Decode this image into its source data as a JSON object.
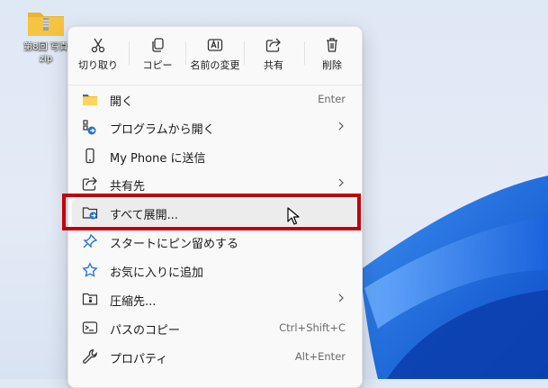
{
  "desktop": {
    "icon_name": "folder-zip-icon",
    "label_line1": "第8回 写真",
    "label_line2": "zip"
  },
  "context_menu": {
    "quick_actions": [
      {
        "label": "切り取り",
        "icon": "scissors-icon"
      },
      {
        "label": "コピー",
        "icon": "copy-icon"
      },
      {
        "label": "名前の変更",
        "icon": "rename-icon"
      },
      {
        "label": "共有",
        "icon": "share-icon"
      },
      {
        "label": "削除",
        "icon": "trash-icon"
      }
    ],
    "items": [
      {
        "label": "開く",
        "shortcut": "Enter",
        "icon": "folder-open-icon",
        "submenu": false
      },
      {
        "label": "プログラムから開く",
        "shortcut": "",
        "icon": "open-with-icon",
        "submenu": true
      },
      {
        "label": "My Phone に送信",
        "shortcut": "",
        "icon": "phone-icon",
        "submenu": false
      },
      {
        "label": "共有先",
        "shortcut": "",
        "icon": "share-icon",
        "submenu": true
      },
      {
        "label": "すべて展開...",
        "shortcut": "",
        "icon": "extract-all-icon",
        "submenu": false
      },
      {
        "label": "スタートにピン留めする",
        "shortcut": "",
        "icon": "pin-icon",
        "submenu": false
      },
      {
        "label": "お気に入りに追加",
        "shortcut": "",
        "icon": "star-icon",
        "submenu": false
      },
      {
        "label": "圧縮先...",
        "shortcut": "",
        "icon": "compress-icon",
        "submenu": true
      },
      {
        "label": "パスのコピー",
        "shortcut": "Ctrl+Shift+C",
        "icon": "copy-path-icon",
        "submenu": false
      },
      {
        "label": "プロパティ",
        "shortcut": "Alt+Enter",
        "icon": "wrench-icon",
        "submenu": false
      }
    ]
  },
  "colors": {
    "highlight_border": "#c0000c",
    "accent_blue": "#1f6fd6",
    "folder_yellow": "#f4c542"
  }
}
